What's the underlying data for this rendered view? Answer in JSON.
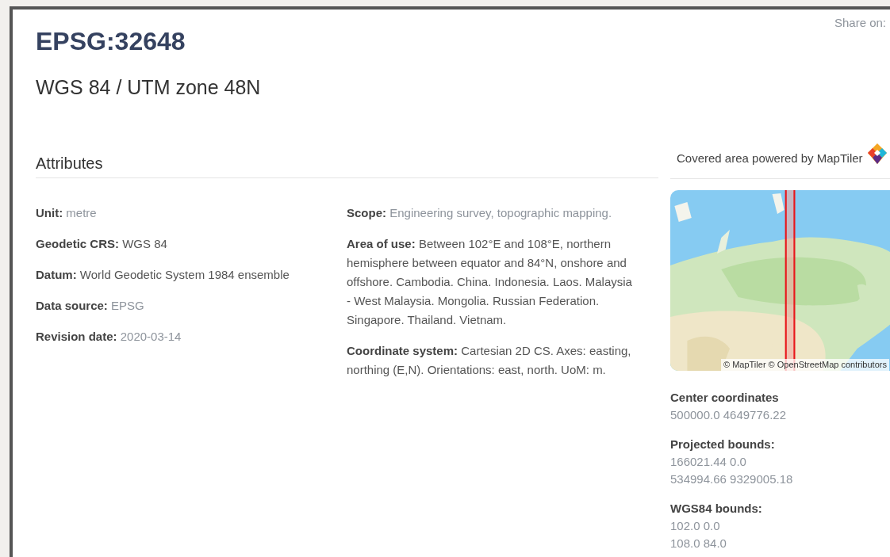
{
  "share_label": "Share on:",
  "code": "EPSG:32648",
  "name": "WGS 84 / UTM zone 48N",
  "attributes": {
    "heading": "Attributes",
    "left": [
      {
        "label": "Unit:",
        "value": "metre",
        "muted": true
      },
      {
        "label": "Geodetic CRS:",
        "value": "WGS 84",
        "muted": false
      },
      {
        "label": "Datum:",
        "value": "World Geodetic System 1984 ensemble",
        "muted": false
      },
      {
        "label": "Data source:",
        "value": "EPSG",
        "muted": true
      },
      {
        "label": "Revision date:",
        "value": "2020-03-14",
        "muted": true
      }
    ],
    "right": [
      {
        "label": "Scope:",
        "value": "Engineering survey, topographic mapping.",
        "muted": true
      },
      {
        "label": "Area of use:",
        "value": "Between 102°E and 108°E, northern hemisphere between equator and 84°N, onshore and offshore. Cambodia. China. Indonesia. Laos. Malaysia - West Malaysia. Mongolia. Russian Federation. Singapore. Thailand. Vietnam.",
        "muted": false
      },
      {
        "label": "Coordinate system:",
        "value": "Cartesian 2D CS. Axes: easting, northing (E,N). Orientations: east, north. UoM: m.",
        "muted": false
      }
    ]
  },
  "map": {
    "heading": "Covered area powered by MapTiler",
    "kind": "picture",
    "attribution": "© MapTiler © OpenStreetMap contributors"
  },
  "details": [
    {
      "label": "Center coordinates",
      "lines": [
        "500000.0 4649776.22"
      ]
    },
    {
      "label": "Projected bounds:",
      "lines": [
        "166021.44 0.0",
        "534994.66 9329005.18"
      ]
    },
    {
      "label": "WGS84 bounds:",
      "lines": [
        "102.0 0.0",
        "108.0 84.0"
      ]
    }
  ]
}
